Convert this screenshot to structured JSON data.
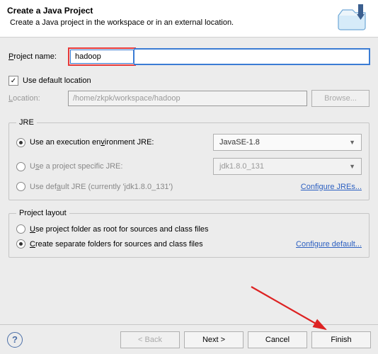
{
  "header": {
    "title": "Create a Java Project",
    "subtitle": "Create a Java project in the workspace or in an external location."
  },
  "project_name": {
    "label": "Project name:",
    "value": "hadoop"
  },
  "location": {
    "use_default_label": "Use default location",
    "use_default_checked": true,
    "location_label": "Location:",
    "location_value": "/home/zkpk/workspace/hadoop",
    "browse_label": "Browse..."
  },
  "jre": {
    "legend": "JRE",
    "opt_env_label": "Use an execution environment JRE:",
    "env_value": "JavaSE-1.8",
    "opt_specific_label": "Use a project specific JRE:",
    "specific_value": "jdk1.8.0_131",
    "opt_default_label": "Use default JRE (currently 'jdk1.8.0_131')",
    "configure_link": "Configure JREs..."
  },
  "layout": {
    "legend": "Project layout",
    "opt_root_label": "Use project folder as root for sources and class files",
    "opt_separate_label": "Create separate folders for sources and class files",
    "configure_link": "Configure default..."
  },
  "footer": {
    "back": "< Back",
    "next": "Next >",
    "cancel": "Cancel",
    "finish": "Finish"
  }
}
